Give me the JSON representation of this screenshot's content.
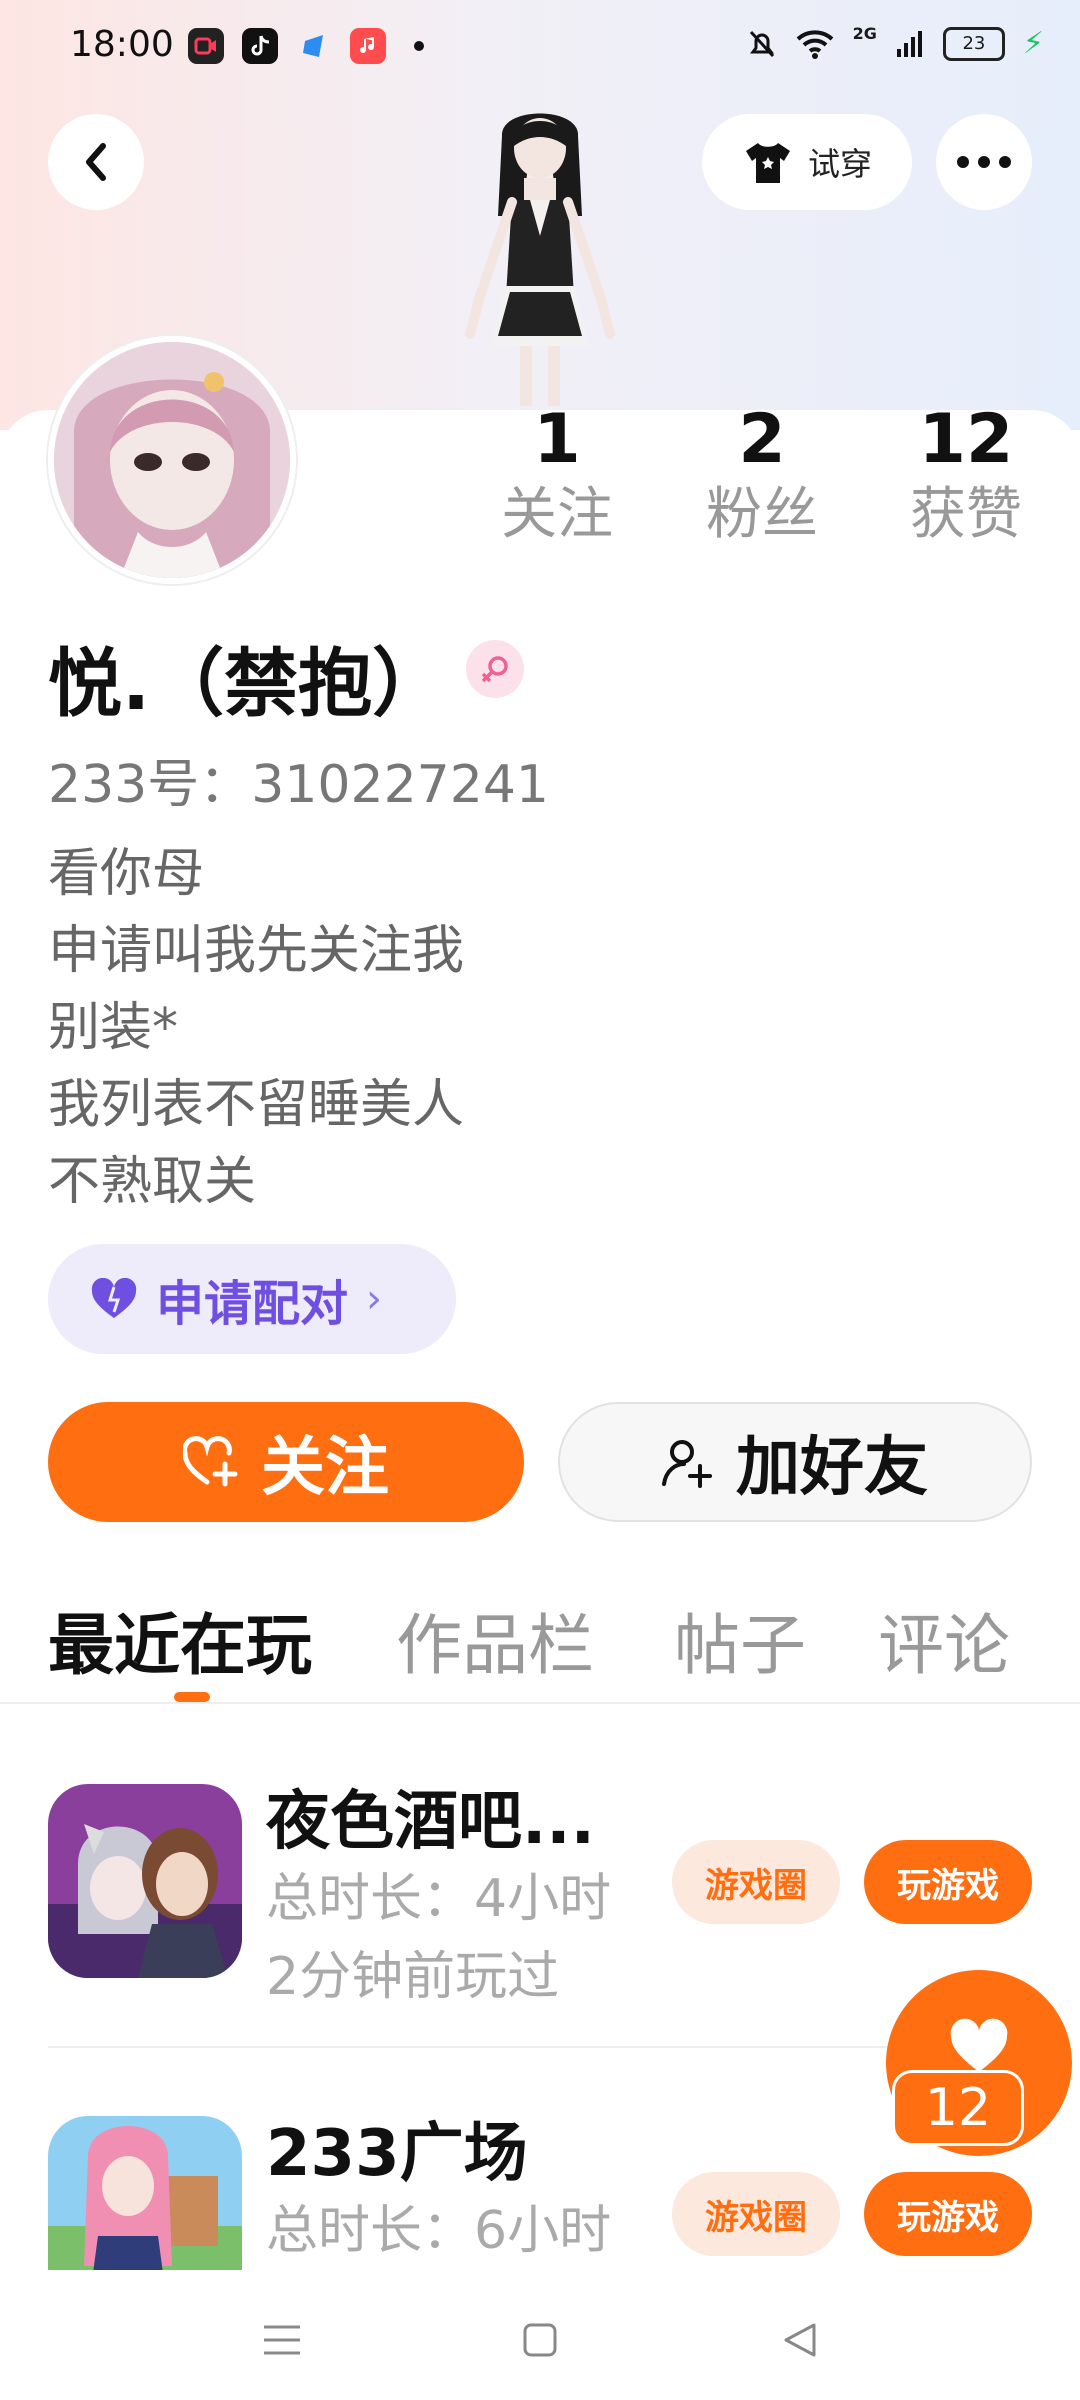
{
  "status_bar": {
    "time": "18:00",
    "apps": [
      "video-app-icon",
      "tiktok-icon",
      "blue-app-icon",
      "music-app-icon"
    ],
    "network": "2G",
    "battery": "23"
  },
  "header": {
    "tryon_label": "试穿"
  },
  "stats": [
    {
      "value": "1",
      "label": "关注"
    },
    {
      "value": "2",
      "label": "粉丝"
    },
    {
      "value": "12",
      "label": "获赞"
    }
  ],
  "profile": {
    "nickname": "悦.（禁抱）",
    "gender_icon": "female-icon",
    "id_line": "233号：310227241",
    "bio": [
      "看你母",
      "申请叫我先关注我",
      "别装*",
      "我列表不留睡美人",
      "不熟取关"
    ]
  },
  "pair_button": {
    "label": "申请配对"
  },
  "actions": {
    "follow_label": "关注",
    "add_friend_label": "加好友"
  },
  "tabs": [
    {
      "label": "最近在玩",
      "active": true
    },
    {
      "label": "作品栏",
      "active": false
    },
    {
      "label": "帖子",
      "active": false
    },
    {
      "label": "评论",
      "active": false
    }
  ],
  "games": [
    {
      "name": "夜色酒吧...",
      "duration": "总时长：4小时",
      "last_played": "2分钟前玩过",
      "circle_label": "游戏圈",
      "play_label": "玩游戏"
    },
    {
      "name": "233广场",
      "duration": "总时长：6小时",
      "circle_label": "游戏圈",
      "play_label": "玩游戏"
    }
  ],
  "like_float": {
    "count": "12"
  },
  "colors": {
    "accent": "#ff6f12",
    "pair_purple": "#6f4fe0"
  }
}
